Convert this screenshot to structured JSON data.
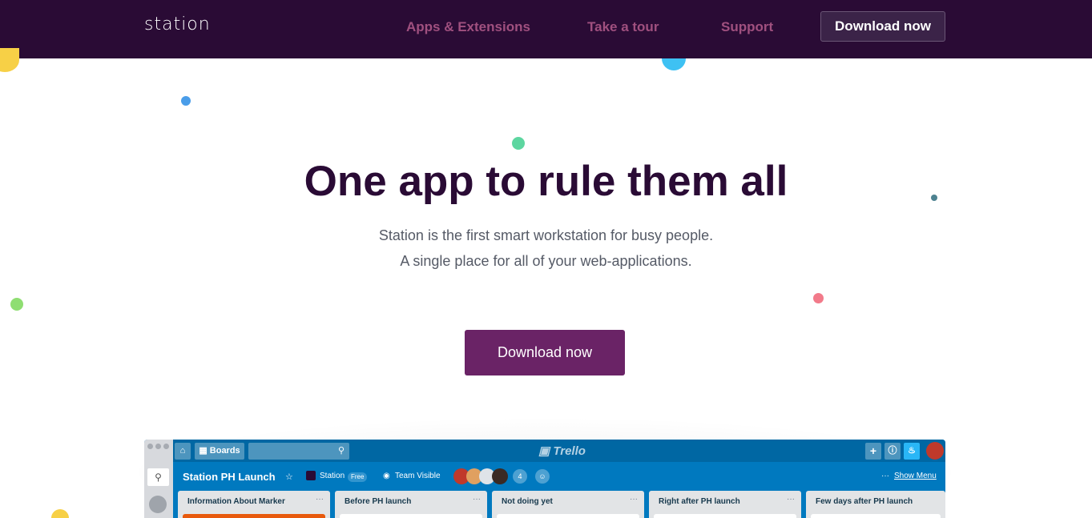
{
  "nav": {
    "logo": "station",
    "links": [
      "Apps & Extensions",
      "Take a tour",
      "Support"
    ],
    "download_label": "Download now"
  },
  "hero": {
    "title": "One app to rule them all",
    "subtitle_line1": "Station is the first smart workstation for busy people.",
    "subtitle_line2": "A single place for all of your web-applications.",
    "download_label": "Download now"
  },
  "preview": {
    "boards_label": "Boards",
    "app_logo": "Trello",
    "board_title": "Station PH Launch",
    "team_label": "Station",
    "free_badge": "Free",
    "visibility": "Team Visible",
    "member_count": "4",
    "show_menu": "Show Menu",
    "lists": [
      "Information About Marker",
      "Before PH launch",
      "Not doing yet",
      "Right after PH launch",
      "Few days after PH launch"
    ],
    "list_menu": "···"
  },
  "colors": {
    "nav_bg": "#2a0b35",
    "nav_link": "#a0507f",
    "hero_btn": "#6a2366",
    "trello_blue": "#0079bf"
  }
}
